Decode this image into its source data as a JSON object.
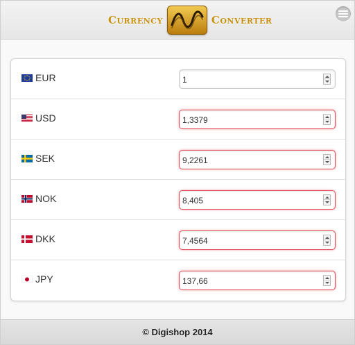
{
  "header": {
    "logo_left": "Currency",
    "logo_right": "Converter",
    "menu_icon": "hamburger-circle-icon"
  },
  "currencies": [
    {
      "code": "EUR",
      "flag": "eu-flag-icon",
      "value": "1",
      "invalid": false
    },
    {
      "code": "USD",
      "flag": "us-flag-icon",
      "value": "1,3379",
      "invalid": true
    },
    {
      "code": "SEK",
      "flag": "se-flag-icon",
      "value": "9,2261",
      "invalid": true
    },
    {
      "code": "NOK",
      "flag": "no-flag-icon",
      "value": "8,405",
      "invalid": true
    },
    {
      "code": "DKK",
      "flag": "dk-flag-icon",
      "value": "7,4564",
      "invalid": true
    },
    {
      "code": "JPY",
      "flag": "jp-flag-icon",
      "value": "137,66",
      "invalid": true
    }
  ],
  "footer": {
    "text": "© Digishop 2014"
  },
  "colors": {
    "logo_gold": "#c99312",
    "invalid_border": "#e0555c",
    "background": "#f9f9f9"
  }
}
